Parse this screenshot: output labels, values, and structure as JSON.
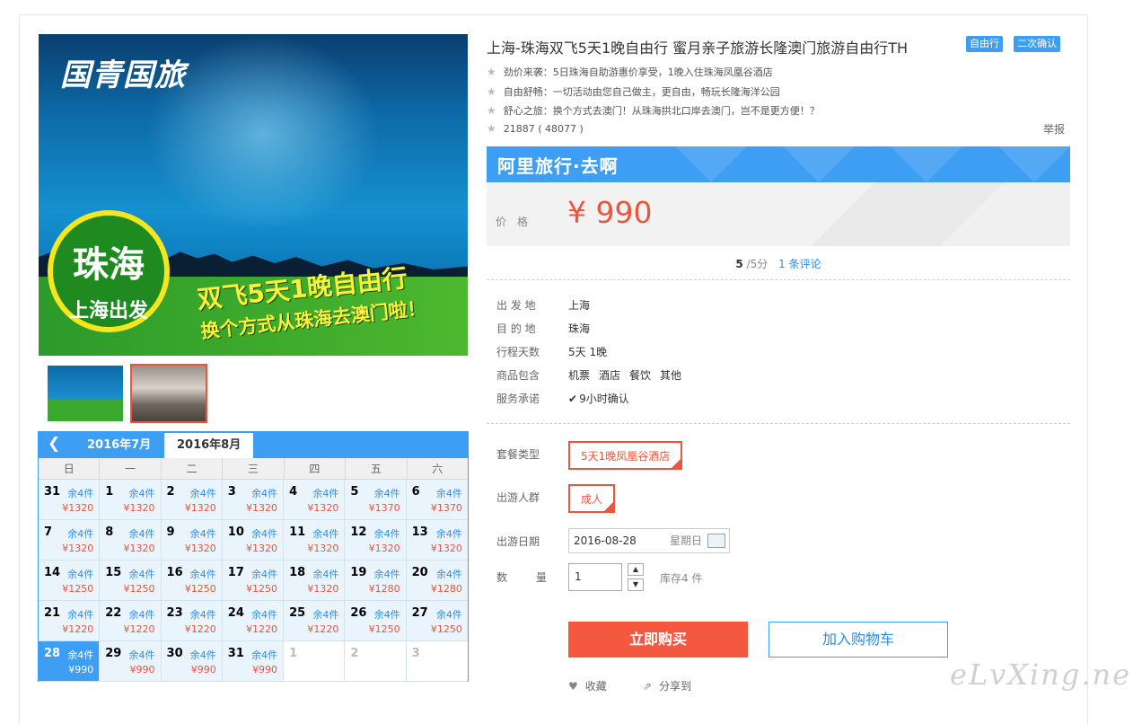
{
  "main_image": {
    "brand": "国青国旅",
    "circle_big": "珠海",
    "circle_small": "上海出发",
    "slogan1": "双飞5天1晚自由行",
    "slogan2": "换个方式从珠海去澳门啦！"
  },
  "calendar": {
    "prev_icon": "chevron-left-icon",
    "tabs": [
      "2016年7月",
      "2016年8月"
    ],
    "active_tab": "2016年8月",
    "weekdays": [
      "日",
      "一",
      "二",
      "三",
      "四",
      "五",
      "六"
    ],
    "days": [
      {
        "d": "31",
        "s": "余4件",
        "p": "¥1320"
      },
      {
        "d": "1",
        "s": "余4件",
        "p": "¥1320"
      },
      {
        "d": "2",
        "s": "余4件",
        "p": "¥1320"
      },
      {
        "d": "3",
        "s": "余4件",
        "p": "¥1320"
      },
      {
        "d": "4",
        "s": "余4件",
        "p": "¥1320"
      },
      {
        "d": "5",
        "s": "余4件",
        "p": "¥1370"
      },
      {
        "d": "6",
        "s": "余4件",
        "p": "¥1370"
      },
      {
        "d": "7",
        "s": "余4件",
        "p": "¥1320"
      },
      {
        "d": "8",
        "s": "余4件",
        "p": "¥1320"
      },
      {
        "d": "9",
        "s": "余4件",
        "p": "¥1320"
      },
      {
        "d": "10",
        "s": "余4件",
        "p": "¥1320"
      },
      {
        "d": "11",
        "s": "余4件",
        "p": "¥1320"
      },
      {
        "d": "12",
        "s": "余4件",
        "p": "¥1320"
      },
      {
        "d": "13",
        "s": "余4件",
        "p": "¥1320"
      },
      {
        "d": "14",
        "s": "余4件",
        "p": "¥1250"
      },
      {
        "d": "15",
        "s": "余4件",
        "p": "¥1250"
      },
      {
        "d": "16",
        "s": "余4件",
        "p": "¥1250"
      },
      {
        "d": "17",
        "s": "余4件",
        "p": "¥1250"
      },
      {
        "d": "18",
        "s": "余4件",
        "p": "¥1320"
      },
      {
        "d": "19",
        "s": "余4件",
        "p": "¥1280"
      },
      {
        "d": "20",
        "s": "余4件",
        "p": "¥1280"
      },
      {
        "d": "21",
        "s": "余4件",
        "p": "¥1220"
      },
      {
        "d": "22",
        "s": "余4件",
        "p": "¥1220"
      },
      {
        "d": "23",
        "s": "余4件",
        "p": "¥1220"
      },
      {
        "d": "24",
        "s": "余4件",
        "p": "¥1220"
      },
      {
        "d": "25",
        "s": "余4件",
        "p": "¥1220"
      },
      {
        "d": "26",
        "s": "余4件",
        "p": "¥1250"
      },
      {
        "d": "27",
        "s": "余4件",
        "p": "¥1250"
      },
      {
        "d": "28",
        "s": "余4件",
        "p": "¥990",
        "selected": true
      },
      {
        "d": "29",
        "s": "余4件",
        "p": "¥990"
      },
      {
        "d": "30",
        "s": "余4件",
        "p": "¥990"
      },
      {
        "d": "31",
        "s": "余4件",
        "p": "¥990"
      },
      {
        "d": "1",
        "s": "",
        "p": "",
        "empty": true
      },
      {
        "d": "2",
        "s": "",
        "p": "",
        "empty": true
      },
      {
        "d": "3",
        "s": "",
        "p": "",
        "empty": true
      }
    ]
  },
  "product": {
    "title": "上海-珠海双飞5天1晚自由行 蜜月亲子旅游长隆澳门旅游自由行TH",
    "tags": [
      "自由行",
      "二次确认"
    ],
    "features": [
      "劲价来袭：5日珠海自助游惠价享受，1晚入住珠海凤凰谷酒店",
      "自由舒畅：一切活动由您自己做主，更自由，畅玩长隆海洋公园",
      "舒心之旅：换个方式去澳门！从珠海拱北口岸去澳门，岂不是更方便！？",
      "21887 ( 48077 )"
    ],
    "report": "举报",
    "brand_bar": "阿里旅行·去啊",
    "price_label": "价格",
    "price": "¥ 990",
    "rating_score": "5",
    "rating_max": "/5分",
    "review_link": "1 条评论"
  },
  "details": [
    {
      "label": "出 发 地",
      "value": [
        "上海"
      ]
    },
    {
      "label": "目 的 地",
      "value": [
        "珠海"
      ]
    },
    {
      "label": "行程天数",
      "value": [
        "5天 1晚"
      ]
    },
    {
      "label": "商品包含",
      "value": [
        "机票",
        "酒店",
        "餐饮",
        "其他"
      ]
    },
    {
      "label": "服务承诺",
      "value": [
        "9小时确认"
      ]
    }
  ],
  "options": {
    "package_label": "套餐类型",
    "package_value": "5天1晚凤凰谷酒店",
    "crowd_label": "出游人群",
    "crowd_value": "成人",
    "date_label": "出游日期",
    "date_value": "2016-08-28",
    "date_weekday": "星期日",
    "qty_label": "数 量",
    "qty_value": "1",
    "stock": "库存4 件"
  },
  "actions": {
    "buy": "立即购买",
    "cart": "加入购物车",
    "favorite": "收藏",
    "share": "分享到"
  },
  "watermark": "eLvXing.net",
  "colors": {
    "accent": "#3e9ef3",
    "price": "#e8563b",
    "buy": "#f4593f"
  }
}
